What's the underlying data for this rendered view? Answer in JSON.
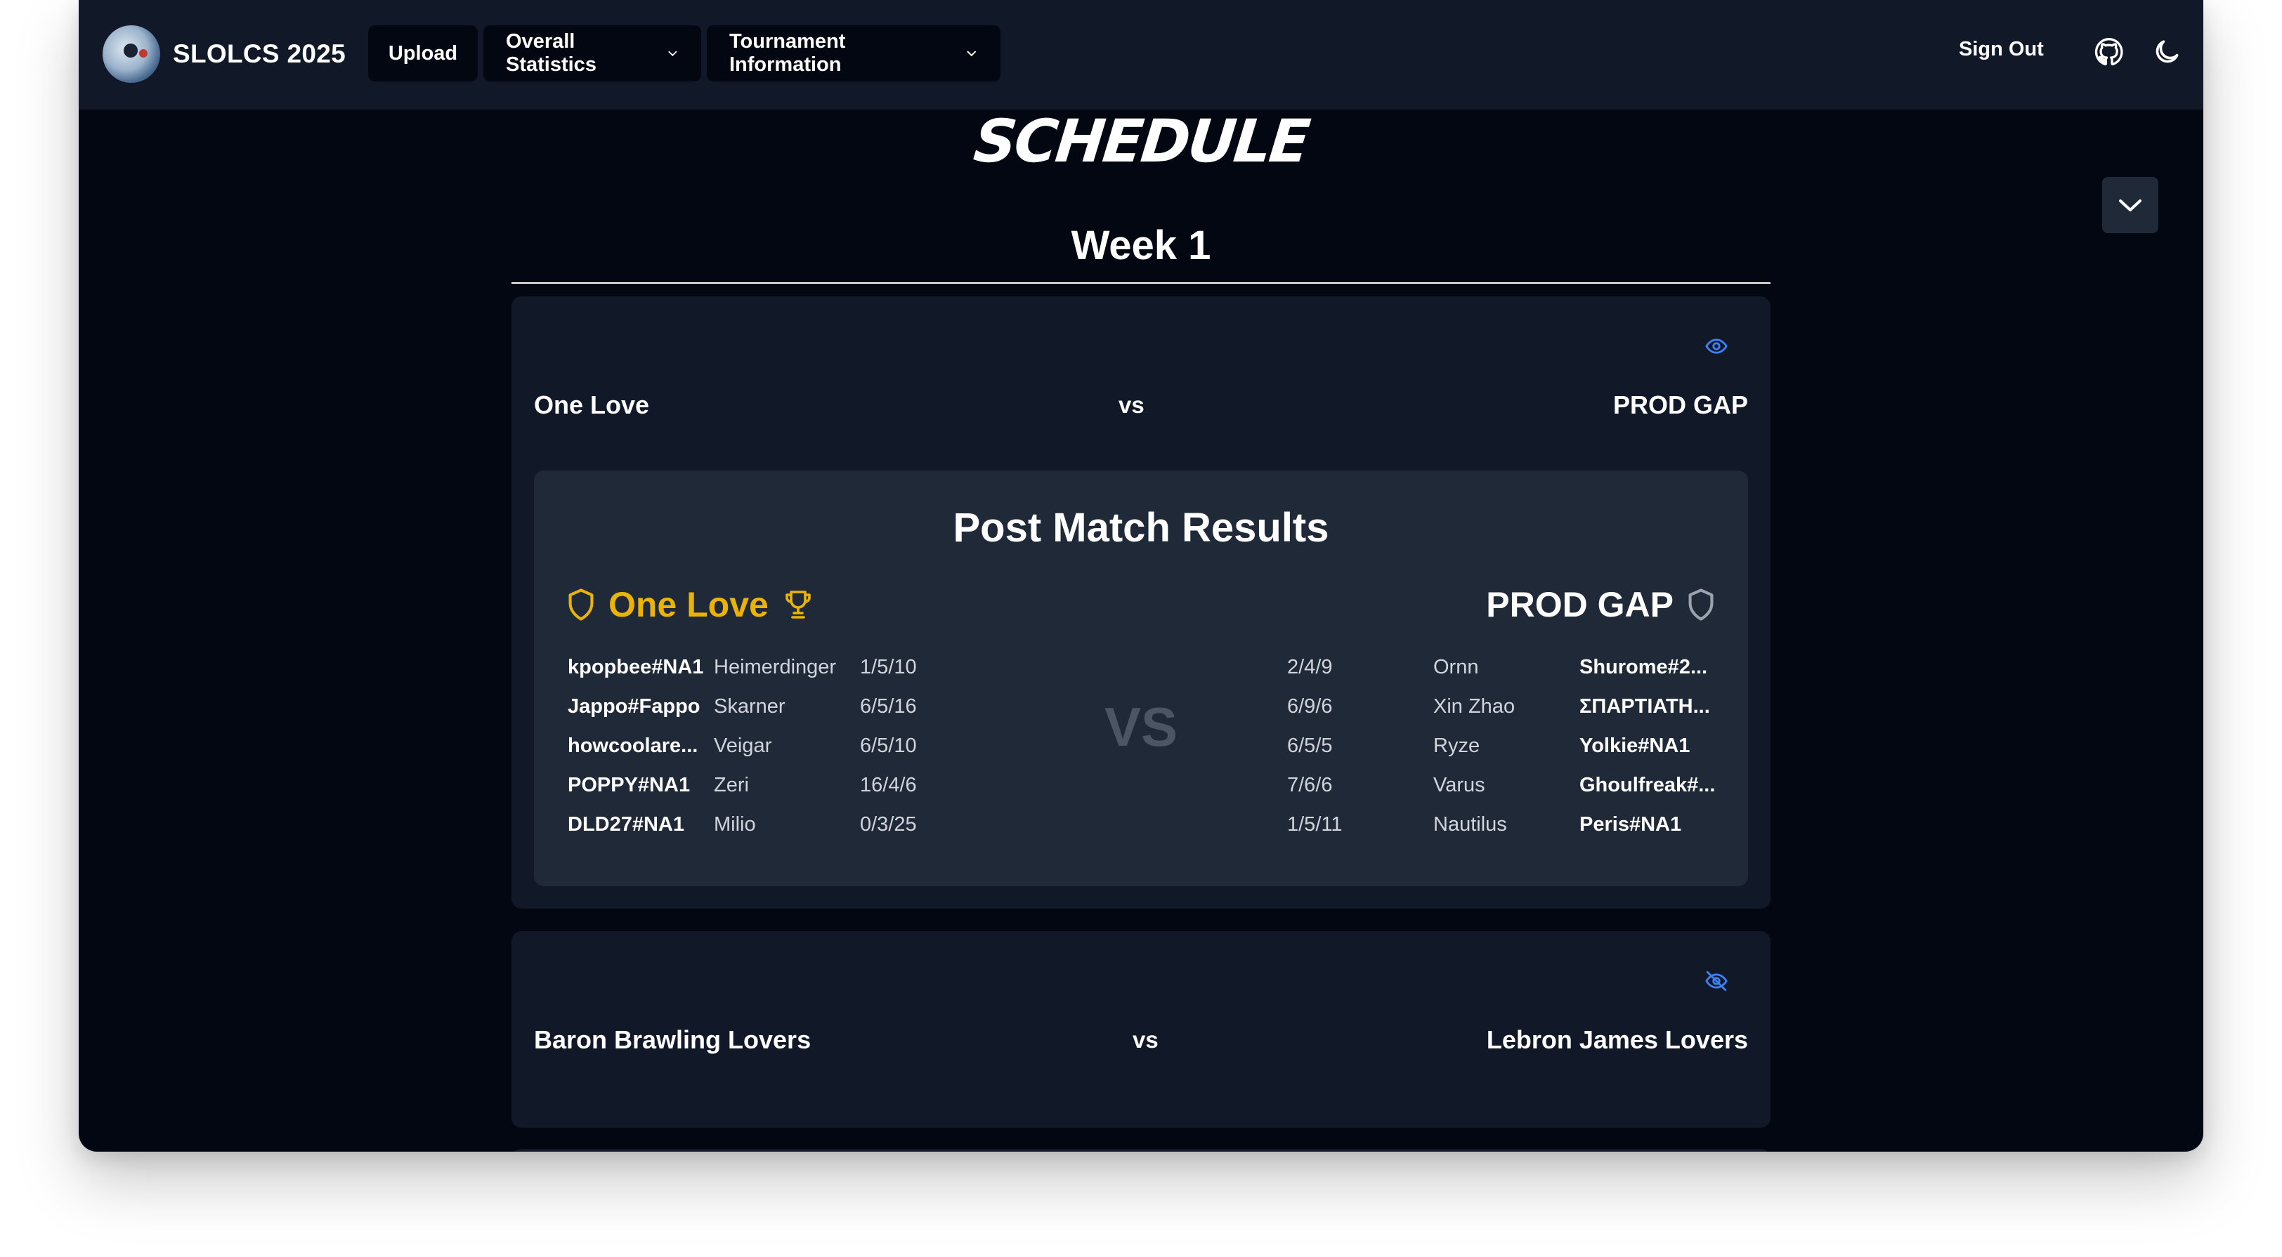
{
  "navbar": {
    "brand": "SLOLCS 2025",
    "upload_label": "Upload",
    "overall_stats_label": "Overall Statistics",
    "tournament_info_label": "Tournament Information",
    "sign_out_label": "Sign Out",
    "icons": [
      "github-icon",
      "moon-icon",
      "chevron-down-icon"
    ]
  },
  "page": {
    "title": "SCHEDULE",
    "week_title": "Week 1"
  },
  "matches": [
    {
      "team_a": "One Love",
      "vs": "vs",
      "team_b": "PROD GAP",
      "visibility_icon": "eye-icon",
      "results": {
        "title": "Post Match Results",
        "winner": "One Love",
        "team_a_name": "One Love",
        "team_b_name": "PROD GAP",
        "vs_label": "VS",
        "team_a_players": [
          {
            "name": "kpopbee#NA1",
            "champion": "Heimerdinger",
            "kda": "1/5/10"
          },
          {
            "name": "Jappo#Fappo",
            "champion": "Skarner",
            "kda": "6/5/16"
          },
          {
            "name": "howcoolare...",
            "champion": "Veigar",
            "kda": "6/5/10"
          },
          {
            "name": "POPPY#NA1",
            "champion": "Zeri",
            "kda": "16/4/6"
          },
          {
            "name": "DLD27#NA1",
            "champion": "Milio",
            "kda": "0/3/25"
          }
        ],
        "team_b_players": [
          {
            "kda": "2/4/9",
            "champion": "Ornn",
            "name": "Shurome#2..."
          },
          {
            "kda": "6/9/6",
            "champion": "Xin Zhao",
            "name": "ΣΠΑΡΤΙΑΤΗ..."
          },
          {
            "kda": "6/5/5",
            "champion": "Ryze",
            "name": "Yolkie#NA1"
          },
          {
            "kda": "7/6/6",
            "champion": "Varus",
            "name": "Ghoulfreak#..."
          },
          {
            "kda": "1/5/11",
            "champion": "Nautilus",
            "name": "Peris#NA1"
          }
        ]
      }
    },
    {
      "team_a": "Baron Brawling Lovers",
      "vs": "vs",
      "team_b": "Lebron James Lovers",
      "visibility_icon": "eye-off-icon"
    }
  ],
  "colors": {
    "background": "#030712",
    "navbar": "#111827",
    "card": "#111827",
    "results_panel": "#1f2937",
    "winner_gold": "#eab308",
    "accent_blue": "#3b82f6",
    "muted_vs": "#4b5563"
  }
}
